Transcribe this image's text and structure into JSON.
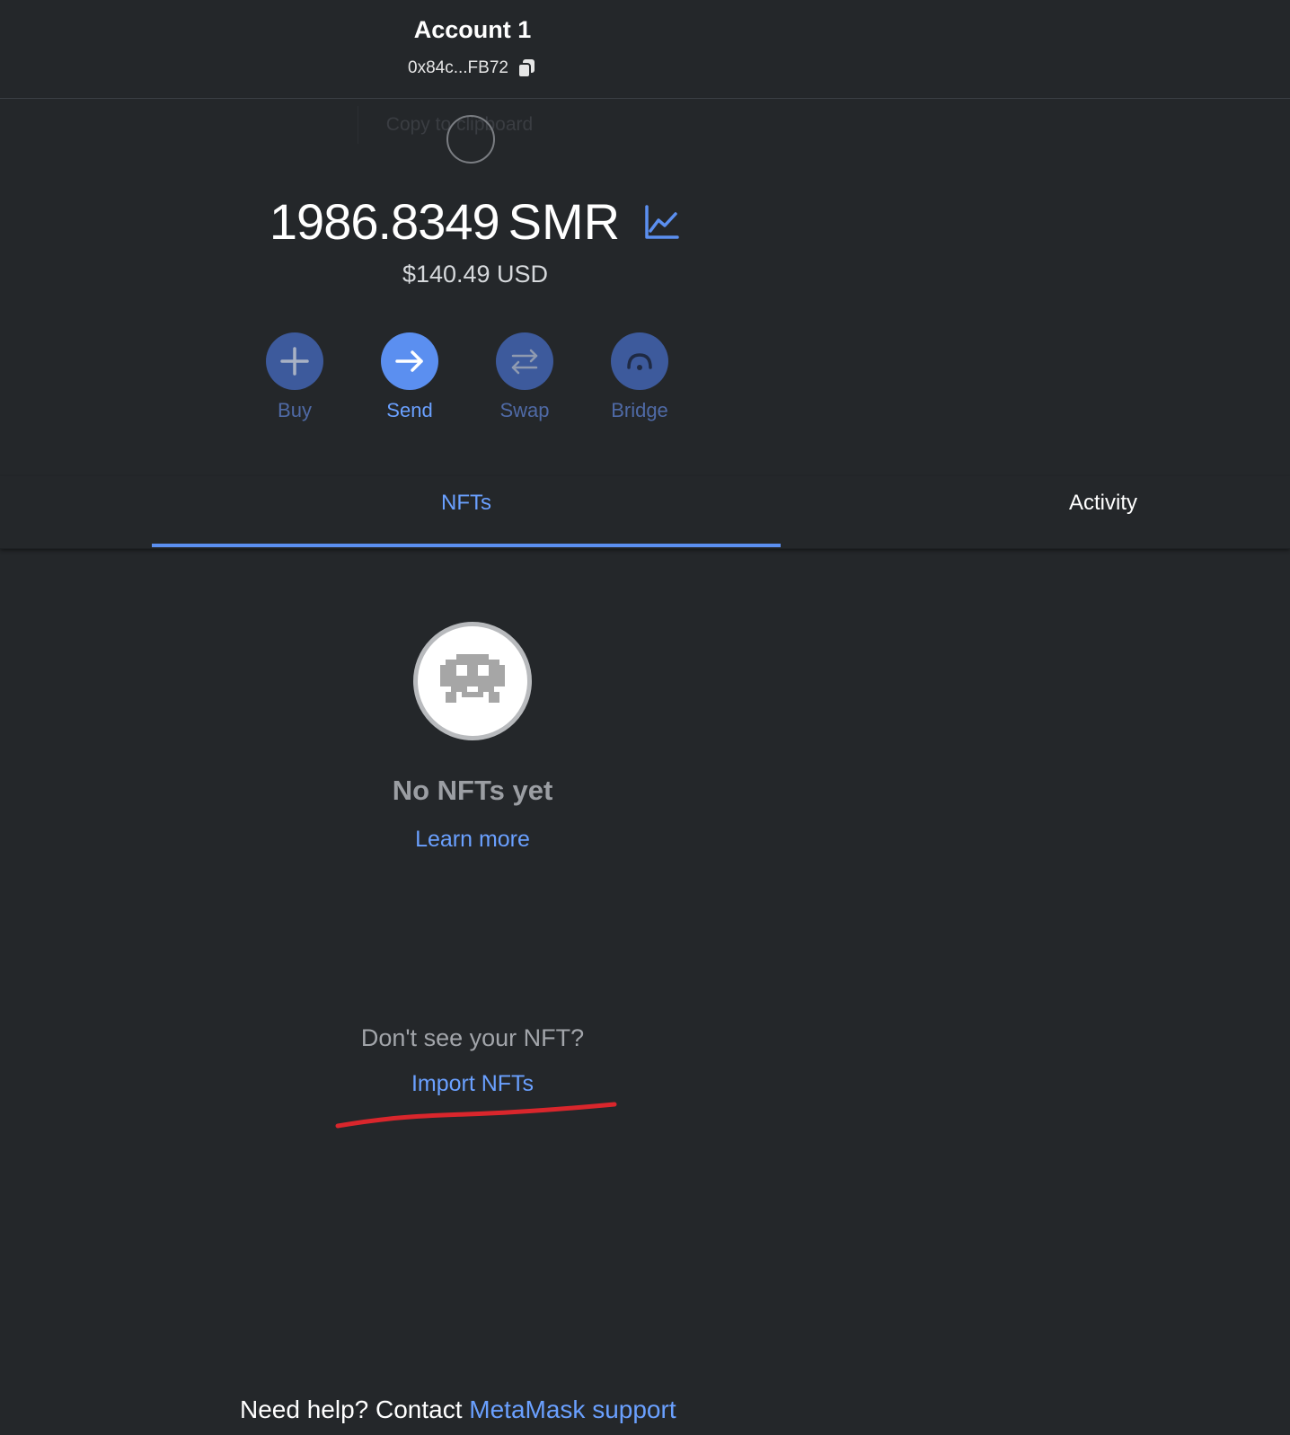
{
  "header": {
    "account_name": "Account 1",
    "address": "0x84c...FB72",
    "tooltip": "Copy to clipboard"
  },
  "balance": {
    "amount": "1986.8349",
    "currency": "SMR",
    "fiat": "$140.49 USD"
  },
  "actions": [
    {
      "label": "Buy",
      "icon": "plus-icon",
      "active": false
    },
    {
      "label": "Send",
      "icon": "arrow-right-icon",
      "active": true
    },
    {
      "label": "Swap",
      "icon": "swap-arrows-icon",
      "active": false
    },
    {
      "label": "Bridge",
      "icon": "bridge-icon",
      "active": false
    }
  ],
  "tabs": {
    "nfts": "NFTs",
    "activity": "Activity",
    "selected": "NFTs"
  },
  "empty_state": {
    "title": "No NFTs yet",
    "learn_more": "Learn more",
    "dont_see": "Don't see your NFT?",
    "import": "Import NFTs"
  },
  "footer": {
    "help_text": "Need help? Contact ",
    "help_link": "MetaMask support"
  },
  "colors": {
    "background": "#24272a",
    "accent": "#6aa0ff",
    "action_inactive": "#3d5a9c",
    "action_active": "#5b8ff0",
    "annotation": "#d9262c"
  }
}
